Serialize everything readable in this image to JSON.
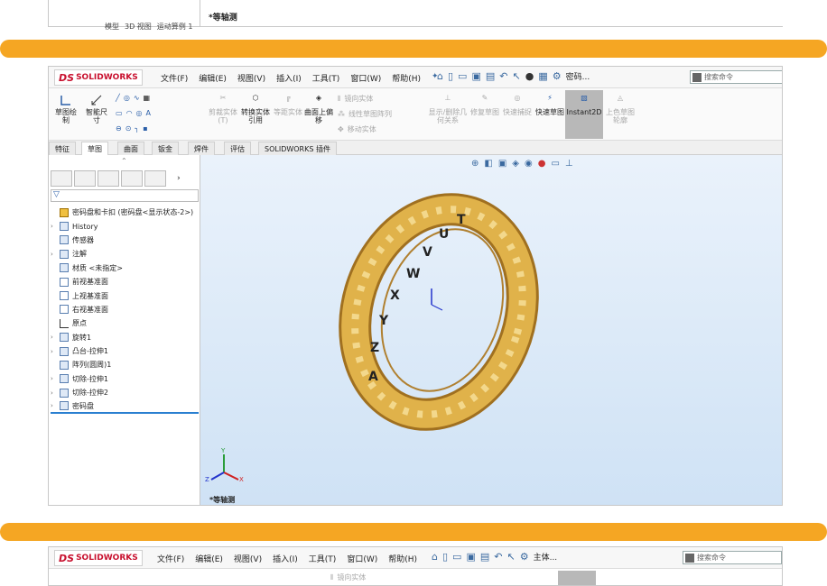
{
  "top_strip": {
    "view_label": "*等轴测",
    "tabs": [
      "模型",
      "3D 视图",
      "运动算例 1"
    ]
  },
  "window": {
    "logo": "SOLIDWORKS",
    "menu": [
      "文件(F)",
      "编辑(E)",
      "视图(V)",
      "插入(I)",
      "工具(T)",
      "窗口(W)",
      "帮助(H)"
    ],
    "doc_name": "密码...",
    "search_placeholder": "搜索命令",
    "ribbon": {
      "sketch": "草图绘制",
      "smart_dim": "智能尺寸",
      "trim": "剪裁实体(T)",
      "convert": "转换实体引用",
      "offset": "等距实体",
      "surface_offset": "曲面上偏移",
      "mirror": "镜向实体",
      "linear_pattern": "线性草图阵列",
      "move": "移动实体",
      "display_relations": "显示/删除几何关系",
      "repair": "修复草图",
      "quick_snap": "快速捕捉",
      "rapid_sketch": "快速草图",
      "instant2d": "Instant2D",
      "shaded_contours": "上色草图轮廓"
    },
    "tabs": [
      "特征",
      "草图",
      "曲面",
      "钣金",
      "焊件",
      "评估",
      "SOLIDWORKS 插件"
    ],
    "active_tab": "草图",
    "tree": [
      {
        "label": "密码盘和卡扣 (密码盘<显示状态-2>)",
        "expand": ""
      },
      {
        "label": "History",
        "expand": "›"
      },
      {
        "label": "传感器",
        "expand": ""
      },
      {
        "label": "注解",
        "expand": "›"
      },
      {
        "label": "材质 <未指定>",
        "expand": ""
      },
      {
        "label": "前视基准面",
        "expand": ""
      },
      {
        "label": "上视基准面",
        "expand": ""
      },
      {
        "label": "右视基准面",
        "expand": ""
      },
      {
        "label": "原点",
        "expand": ""
      },
      {
        "label": "旋转1",
        "expand": "›"
      },
      {
        "label": "凸台-拉伸1",
        "expand": "›"
      },
      {
        "label": "阵列(圆周)1",
        "expand": ""
      },
      {
        "label": "切除-拉伸1",
        "expand": "›"
      },
      {
        "label": "切除-拉伸2",
        "expand": "›"
      },
      {
        "label": "密码盘",
        "expand": "›"
      }
    ],
    "view_label": "*等轴测",
    "ring_letters": [
      "T",
      "U",
      "V",
      "W",
      "X",
      "Y",
      "Z",
      "A"
    ],
    "colors": {
      "accent_bar": "#f5a623",
      "ring": "#e0b24a"
    }
  },
  "bottom_strip": {
    "logo": "SOLIDWORKS",
    "menu": [
      "文件(F)",
      "编辑(E)",
      "视图(V)",
      "插入(I)",
      "工具(T)",
      "窗口(W)",
      "帮助(H)"
    ],
    "doc_name": "主体...",
    "search_placeholder": "搜索命令",
    "mirror": "镜向实体"
  }
}
